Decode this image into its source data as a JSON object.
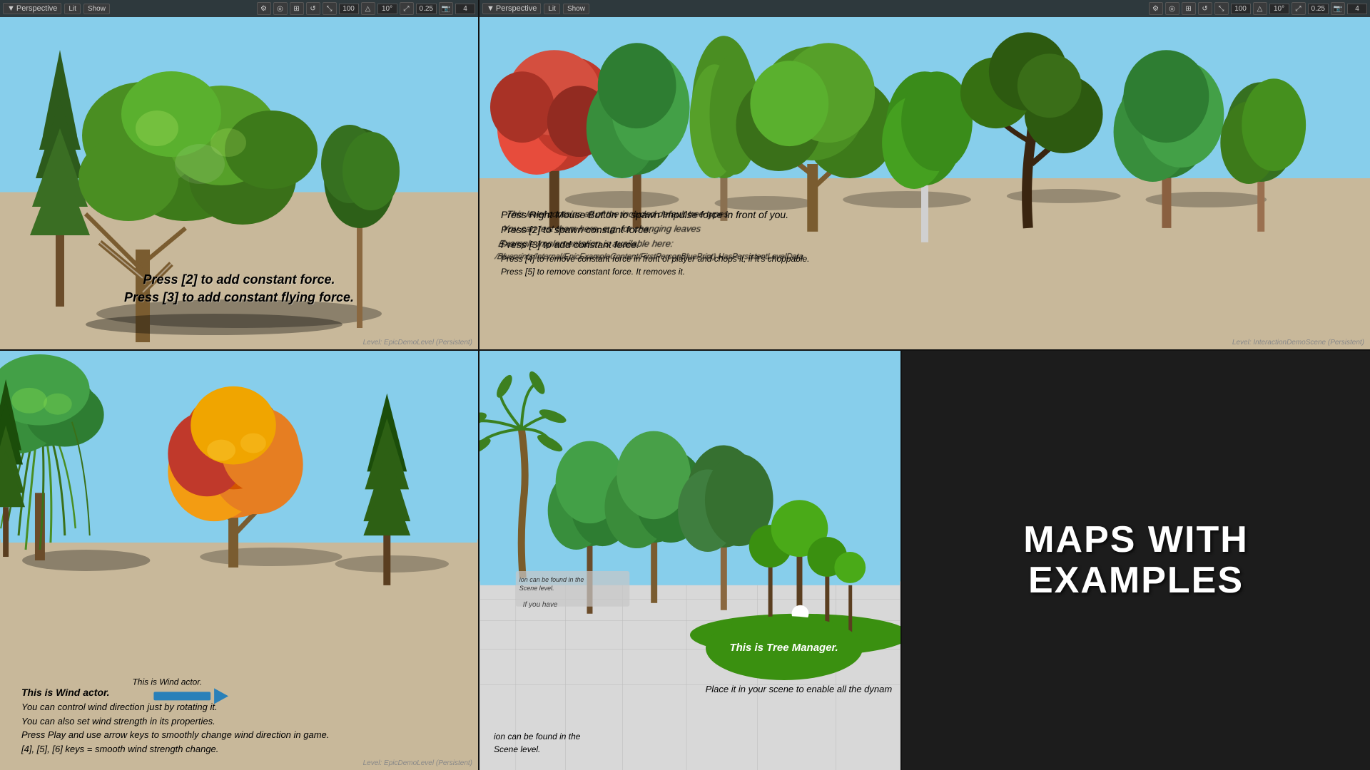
{
  "viewports": {
    "vp1": {
      "toolbar": {
        "perspective_label": "Perspective",
        "lit_label": "Lit",
        "show_label": "Show",
        "num_value": "100",
        "angle_value": "10°",
        "scale_value": "0.25",
        "num2_value": "4"
      },
      "overlay": {
        "line1": "Press [2] to add constant force.",
        "line2": "Press [3] to add constant flying force."
      },
      "level": "Level: EpicDemoLevel (Persistent)"
    },
    "vp2": {
      "toolbar": {
        "perspective_label": "Perspective",
        "lit_label": "Lit",
        "show_label": "Show",
        "num_value": "100",
        "angle_value": "10°",
        "scale_value": "0.25",
        "num2_value": "4"
      },
      "overlay": {
        "line1": "This level contains all of the included default tree types",
        "line2": "You can test them here, e.g. for changing leaves",
        "line3": "Example implementation is available here:",
        "line4": "/Blueprints/Internal/EpicExampleContent/FirstPersonBluePrint) HasPersistentLevelData",
        "line5": "",
        "line6": "Press Right Mouse Button to spawn Impulse force in front of you.",
        "line7": "Press [2] to spawn constant force.",
        "line8": "Press [3] to add constant force.",
        "line9": "Press [4] to remove constant force in front of player and chops it, if it's choppable.",
        "line10": "Press [5] to remove constant force. It removes it."
      },
      "level": "Level: InteractionDemoScene (Persistent)"
    },
    "vp3": {
      "overlay": {
        "wind_label": "This is Wind actor.",
        "line1": "You can control wind direction just by rotating it.",
        "line2": "You can also set wind strength in its properties.",
        "line3": "Press Play and use arrow keys to smoothly change wind direction in game.",
        "line4": "[4], [5], [6] keys = smooth wind strength change."
      },
      "level": "Level: EpicDemoLevel (Persistent)"
    },
    "vp4": {
      "overlay": {
        "line1": "ion can be found in the",
        "line2": "Scene level.",
        "line3": "If you have"
      }
    },
    "vp5": {
      "title_line1": "MAPS WITH",
      "title_line2": "EXAMPLES"
    }
  },
  "tree_manager": {
    "bubble_text": "This is Tree Manager.",
    "sub_text": "Place it in your scene to enable all the dynam"
  }
}
